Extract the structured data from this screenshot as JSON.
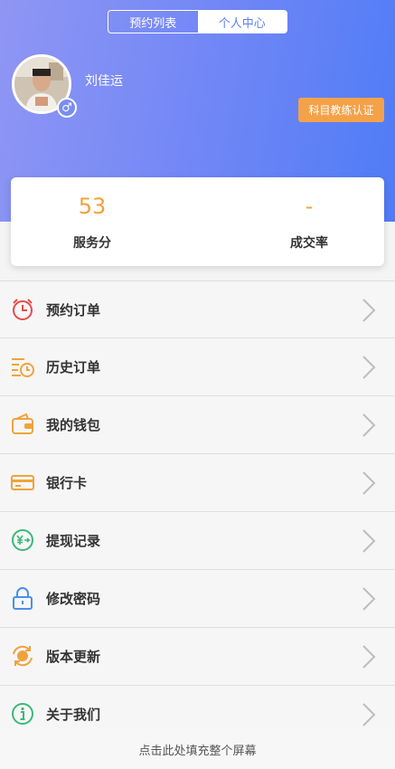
{
  "tabs": [
    {
      "label": "预约列表",
      "active": false
    },
    {
      "label": "个人中心",
      "active": true
    }
  ],
  "profile": {
    "username": "刘佳运",
    "gender_symbol": "♂",
    "cert_button": "科目教练认证"
  },
  "stats": [
    {
      "value": "53",
      "label": "服务分"
    },
    {
      "value": "-",
      "label": "成交率"
    }
  ],
  "menu": [
    {
      "label": "预约订单",
      "icon": "alarm-clock-icon",
      "color": "#e84a4a"
    },
    {
      "label": "历史订单",
      "icon": "history-clock-icon",
      "color": "#f0a33c"
    },
    {
      "label": "我的钱包",
      "icon": "wallet-icon",
      "color": "#f0a33c"
    },
    {
      "label": "银行卡",
      "icon": "bank-card-icon",
      "color": "#f0a33c"
    },
    {
      "label": "提现记录",
      "icon": "withdraw-yen-icon",
      "color": "#3cb878"
    },
    {
      "label": "修改密码",
      "icon": "lock-icon",
      "color": "#4a8ff0"
    },
    {
      "label": "版本更新",
      "icon": "refresh-icon",
      "color": "#f0a33c"
    },
    {
      "label": "关于我们",
      "icon": "info-icon",
      "color": "#3cb878"
    }
  ],
  "footer": "点击此处填充整个屏幕",
  "colors": {
    "accent": "#5b7ff5",
    "orange": "#f0a33c",
    "cert_bg": "#f4a24a"
  }
}
